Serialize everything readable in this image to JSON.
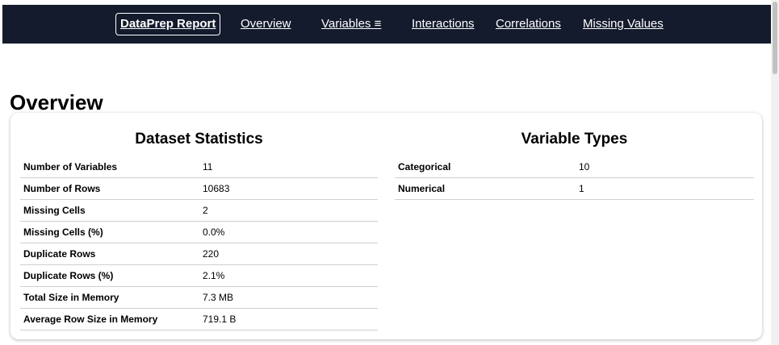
{
  "navbar": {
    "brand": "DataPrep Report",
    "links": {
      "overview": "Overview",
      "variables": "Variables ≡",
      "interactions": "Interactions",
      "correlations": "Correlations",
      "missing_values": "Missing Values"
    }
  },
  "colors": {
    "navbar_bg": "#141b2d",
    "nav_text": "#ffffff"
  },
  "overview": {
    "title": "Overview",
    "dataset_statistics": {
      "title": "Dataset Statistics",
      "rows": [
        {
          "label": "Number of Variables",
          "value": "11"
        },
        {
          "label": "Number of Rows",
          "value": "10683"
        },
        {
          "label": "Missing Cells",
          "value": "2"
        },
        {
          "label": "Missing Cells (%)",
          "value": "0.0%"
        },
        {
          "label": "Duplicate Rows",
          "value": "220"
        },
        {
          "label": "Duplicate Rows (%)",
          "value": "2.1%"
        },
        {
          "label": "Total Size in Memory",
          "value": "7.3 MB"
        },
        {
          "label": "Average Row Size in Memory",
          "value": "719.1 B"
        }
      ]
    },
    "variable_types": {
      "title": "Variable Types",
      "rows": [
        {
          "label": "Categorical",
          "value": "10"
        },
        {
          "label": "Numerical",
          "value": "1"
        }
      ]
    }
  }
}
